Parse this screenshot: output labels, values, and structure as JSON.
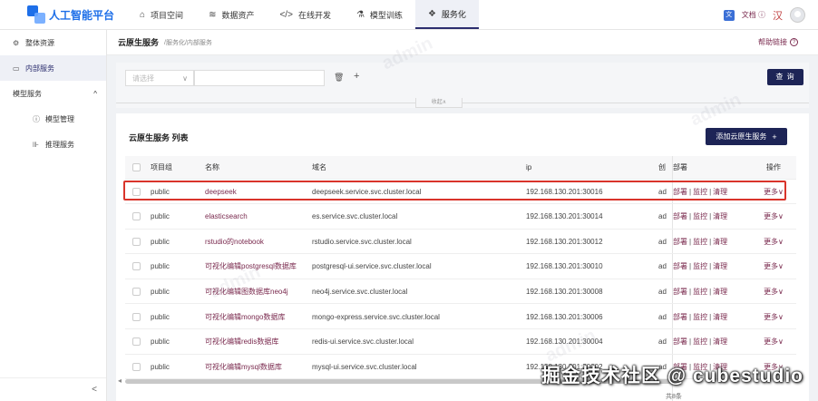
{
  "app": {
    "title": "人工智能平台"
  },
  "nav": [
    {
      "icon": "briefcase-icon",
      "glyph": "⌂",
      "label": "项目空间",
      "active": false
    },
    {
      "icon": "database-icon",
      "glyph": "≋",
      "label": "数据资产",
      "active": false
    },
    {
      "icon": "code-icon",
      "glyph": "</>",
      "label": "在线开发",
      "active": false
    },
    {
      "icon": "training-icon",
      "glyph": "⚗",
      "label": "模型训练",
      "active": false
    },
    {
      "icon": "service-icon",
      "glyph": "❖",
      "label": "服务化",
      "active": true
    }
  ],
  "top_right": {
    "doc_label": "文档 ⓘ",
    "lang_glyph": "汉"
  },
  "sidebar": {
    "items": [
      {
        "icon": "overview-icon",
        "glyph": "⚙",
        "label": "整体资源",
        "active": false
      },
      {
        "icon": "internal-service-icon",
        "glyph": "▭",
        "label": "内部服务",
        "active": true
      }
    ],
    "group": {
      "label": "模型服务",
      "expanded": true
    },
    "sub_items": [
      {
        "icon": "model-manage-icon",
        "glyph": "ⓘ",
        "label": "模型管理"
      },
      {
        "icon": "inference-icon",
        "glyph": "⊪",
        "label": "推理服务"
      }
    ],
    "collapse_glyph": "<"
  },
  "page": {
    "title": "云原生服务",
    "breadcrumb": "/服务化/内部服务",
    "help": "帮助链接"
  },
  "filter": {
    "select_placeholder": "请选择",
    "search_button": "查 询",
    "collapse_label": "收起∧"
  },
  "list": {
    "title": "云原生服务 列表",
    "add_button": "添加云原生服务"
  },
  "table": {
    "columns": {
      "group": "项目组",
      "name": "名称",
      "domain": "域名",
      "ip": "ip",
      "creator": "创",
      "deploy": "部署",
      "ops": "操作"
    },
    "rows": [
      {
        "group": "public",
        "name": "deepseek",
        "domain": "deepseek.service.svc.cluster.local",
        "ip": "192.168.130.201:30016",
        "creator": "ad"
      },
      {
        "group": "public",
        "name": "elasticsearch",
        "domain": "es.service.svc.cluster.local",
        "ip": "192.168.130.201:30014",
        "creator": "ad"
      },
      {
        "group": "public",
        "name": "rstudio的notebook",
        "domain": "rstudio.service.svc.cluster.local",
        "ip": "192.168.130.201:30012",
        "creator": "ad"
      },
      {
        "group": "public",
        "name": "可视化编辑postgresql数据库",
        "domain": "postgresql-ui.service.svc.cluster.local",
        "ip": "192.168.130.201:30010",
        "creator": "ad"
      },
      {
        "group": "public",
        "name": "可视化编辑图数据库neo4j",
        "domain": "neo4j.service.svc.cluster.local",
        "ip": "192.168.130.201:30008",
        "creator": "ad"
      },
      {
        "group": "public",
        "name": "可视化编辑mongo数据库",
        "domain": "mongo-express.service.svc.cluster.local",
        "ip": "192.168.130.201:30006",
        "creator": "ad"
      },
      {
        "group": "public",
        "name": "可视化编辑redis数据库",
        "domain": "redis-ui.service.svc.cluster.local",
        "ip": "192.168.130.201:30004",
        "creator": "ad"
      },
      {
        "group": "public",
        "name": "可视化编辑mysql数据库",
        "domain": "mysql-ui.service.svc.cluster.local",
        "ip": "192.168.130.201:30002",
        "creator": "ad"
      }
    ],
    "row_actions": {
      "deploy": "部署",
      "monitor": "监控",
      "clean": "清理",
      "sep": "|",
      "more": "更多∨"
    }
  },
  "pager_text": "共8条",
  "watermark": "掘金技术社区 @ cubestudio",
  "ghost_mark": "admin",
  "colors": {
    "primary": "#1d2456",
    "link": "#7a2a4e",
    "highlight": "#d9342b",
    "logo": "#1e6fe8"
  }
}
